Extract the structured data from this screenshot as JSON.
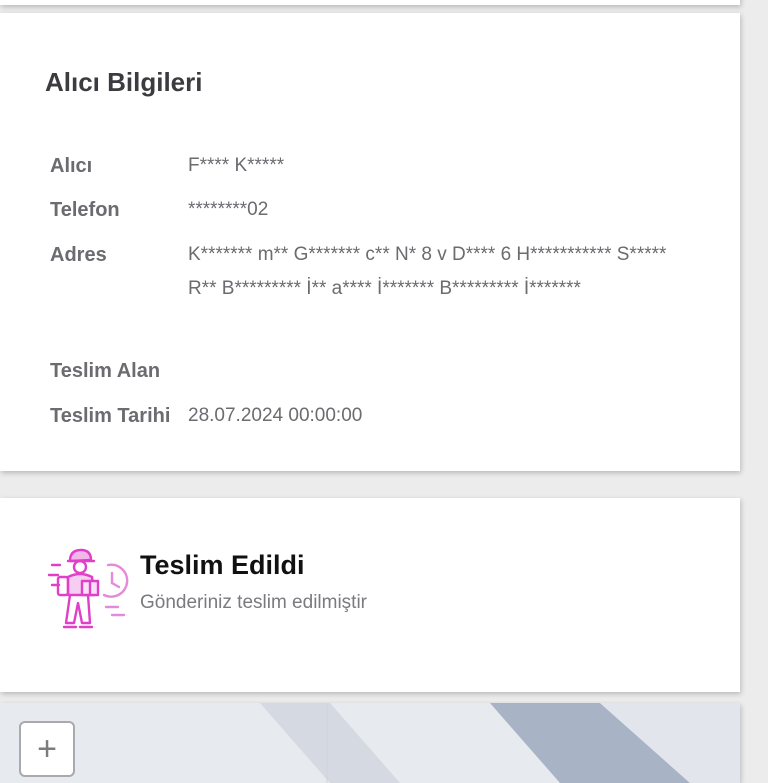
{
  "recipient": {
    "title": "Alıcı Bilgileri",
    "rows": [
      {
        "label": "Alıcı",
        "value": "F**** K*****"
      },
      {
        "label": "Telefon",
        "value": "********02"
      },
      {
        "label": "Adres",
        "value": "K******* m** G******* c** N* 8 v D**** 6 H*********** S***** R** B********* İ** a**** İ******* B********* İ*******"
      },
      {
        "label": "Teslim Alan",
        "value": ""
      },
      {
        "label": "Teslim Tarihi",
        "value": "28.07.2024 00:00:00"
      }
    ]
  },
  "status": {
    "title": "Teslim Edildi",
    "subtitle": "Gönderiniz teslim edilmiştir",
    "icon": "delivery-person-clock-icon",
    "icon_color": "#e040c8"
  },
  "map": {
    "zoom_in_label": "+"
  }
}
